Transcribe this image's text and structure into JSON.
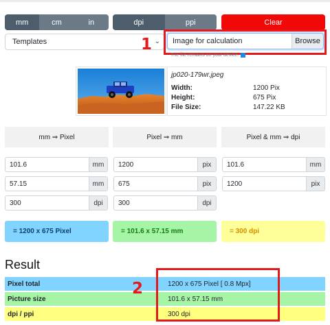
{
  "units": {
    "options": [
      "mm",
      "cm",
      "in"
    ]
  },
  "resolution": {
    "options": [
      "dpi",
      "ppi"
    ]
  },
  "clear_label": "Clear",
  "templates": {
    "label": "Templates"
  },
  "file_input": {
    "placeholder": "Image for calculation",
    "browse_label": "Browse",
    "note": "The file remains on your device."
  },
  "image_info": {
    "filename": "jp020-179wr.jpeg",
    "width_label": "Width:",
    "width_value": "1200 Pix",
    "height_label": "Height:",
    "height_value": "675 Pix",
    "size_label": "File Size:",
    "size_value": "147.22 KB"
  },
  "columns": [
    {
      "header": "mm ⇒ Pixel",
      "fields": [
        {
          "value": "101.6",
          "unit": "mm"
        },
        {
          "value": "57.15",
          "unit": "mm"
        },
        {
          "value": "300",
          "unit": "dpi"
        }
      ],
      "result": "= 1200 x 675 Pixel"
    },
    {
      "header": "Pixel ⇒ mm",
      "fields": [
        {
          "value": "1200",
          "unit": "pix"
        },
        {
          "value": "675",
          "unit": "pix"
        },
        {
          "value": "300",
          "unit": "dpi"
        }
      ],
      "result": "= 101.6 x 57.15 mm"
    },
    {
      "header": "Pixel & mm ⇒ dpi",
      "fields": [
        {
          "value": "101.6",
          "unit": "mm"
        },
        {
          "value": "1200",
          "unit": "pix"
        }
      ],
      "result": "= 300 dpi"
    }
  ],
  "result": {
    "title": "Result",
    "rows": [
      {
        "label": "Pixel total",
        "value": "1200 x 675 Pixel [ 0.8 Mpx]"
      },
      {
        "label": "Picture size",
        "value": "101.6 x 57.15 mm"
      },
      {
        "label": "dpi / ppi",
        "value": "300 dpi"
      }
    ]
  },
  "annotations": {
    "badge1": "1",
    "badge2": "2"
  },
  "colors": {
    "clear": "#f30808",
    "blue_result": "#80d4ff",
    "green_result": "#a6f5a6",
    "yellow_result": "#ffff99",
    "highlight": "#e4191c"
  }
}
